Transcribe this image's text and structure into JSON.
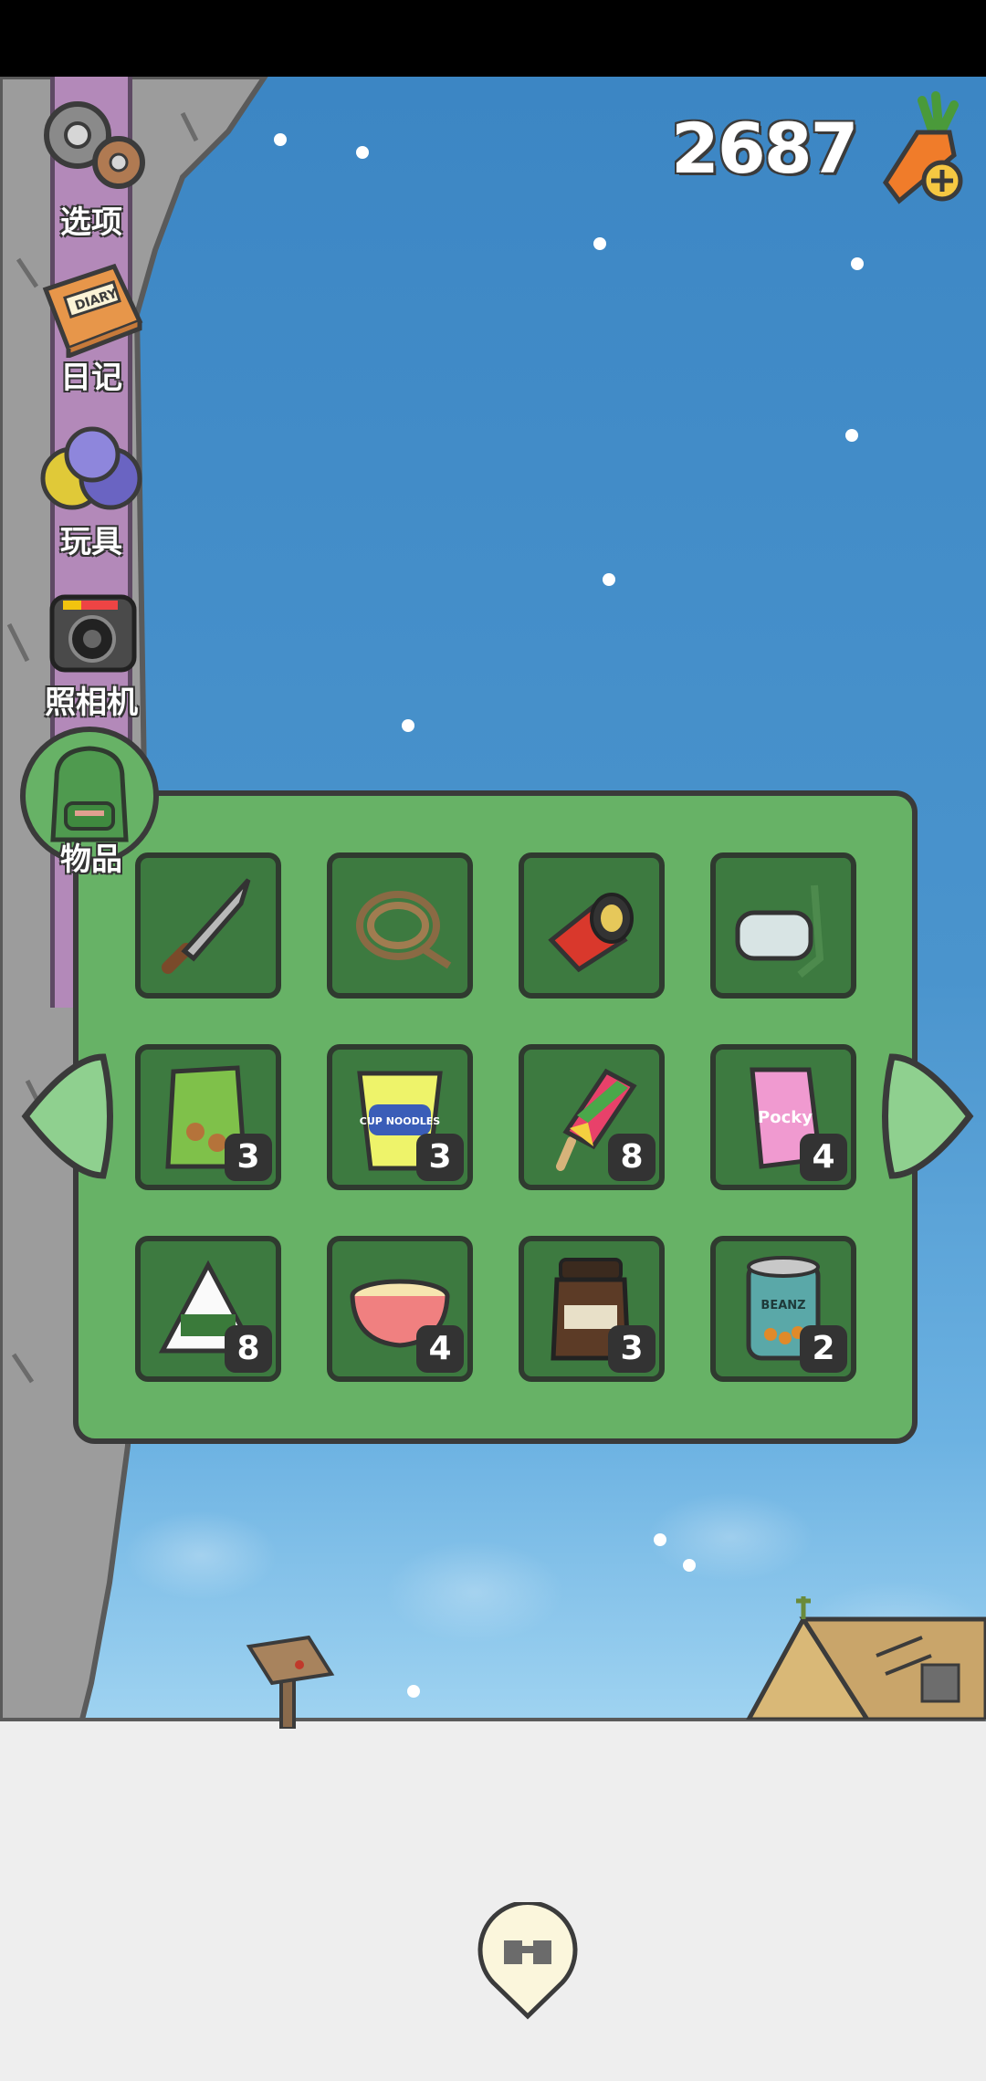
{
  "hud": {
    "carrot_count": "2687",
    "carrot_icon": "carrot-plus-icon"
  },
  "sidebar": {
    "items": [
      {
        "label": "选项",
        "icon": "gears-icon"
      },
      {
        "label": "日记",
        "icon": "diary-icon"
      },
      {
        "label": "玩具",
        "icon": "toy-balls-icon"
      },
      {
        "label": "照相机",
        "icon": "camera-icon"
      },
      {
        "label": "物品",
        "icon": "backpack-icon"
      }
    ]
  },
  "inventory": {
    "slots": [
      {
        "item": "machete",
        "qty": ""
      },
      {
        "item": "rope",
        "qty": ""
      },
      {
        "item": "flashlight",
        "qty": ""
      },
      {
        "item": "snorkel-mask",
        "qty": ""
      },
      {
        "item": "snack-bag",
        "qty": "3"
      },
      {
        "item": "cup-noodles",
        "qty": "3"
      },
      {
        "item": "popsicle",
        "qty": "8"
      },
      {
        "item": "pocky-box",
        "qty": "4"
      },
      {
        "item": "onigiri",
        "qty": "8"
      },
      {
        "item": "ramen-bowl",
        "qty": "4"
      },
      {
        "item": "chocolate-spread-jar",
        "qty": "3"
      },
      {
        "item": "beans-can",
        "qty": "2"
      }
    ],
    "item_text": {
      "cup_noodles": "CUP NOODLES",
      "pocky": "Pocky",
      "beans": "BEANZ",
      "diary": "DIARY"
    }
  },
  "colors": {
    "panel": "#67b266",
    "slot": "#3d7a40",
    "arrow": "#8fd08f",
    "sidebar_pillar": "#b389b9"
  }
}
